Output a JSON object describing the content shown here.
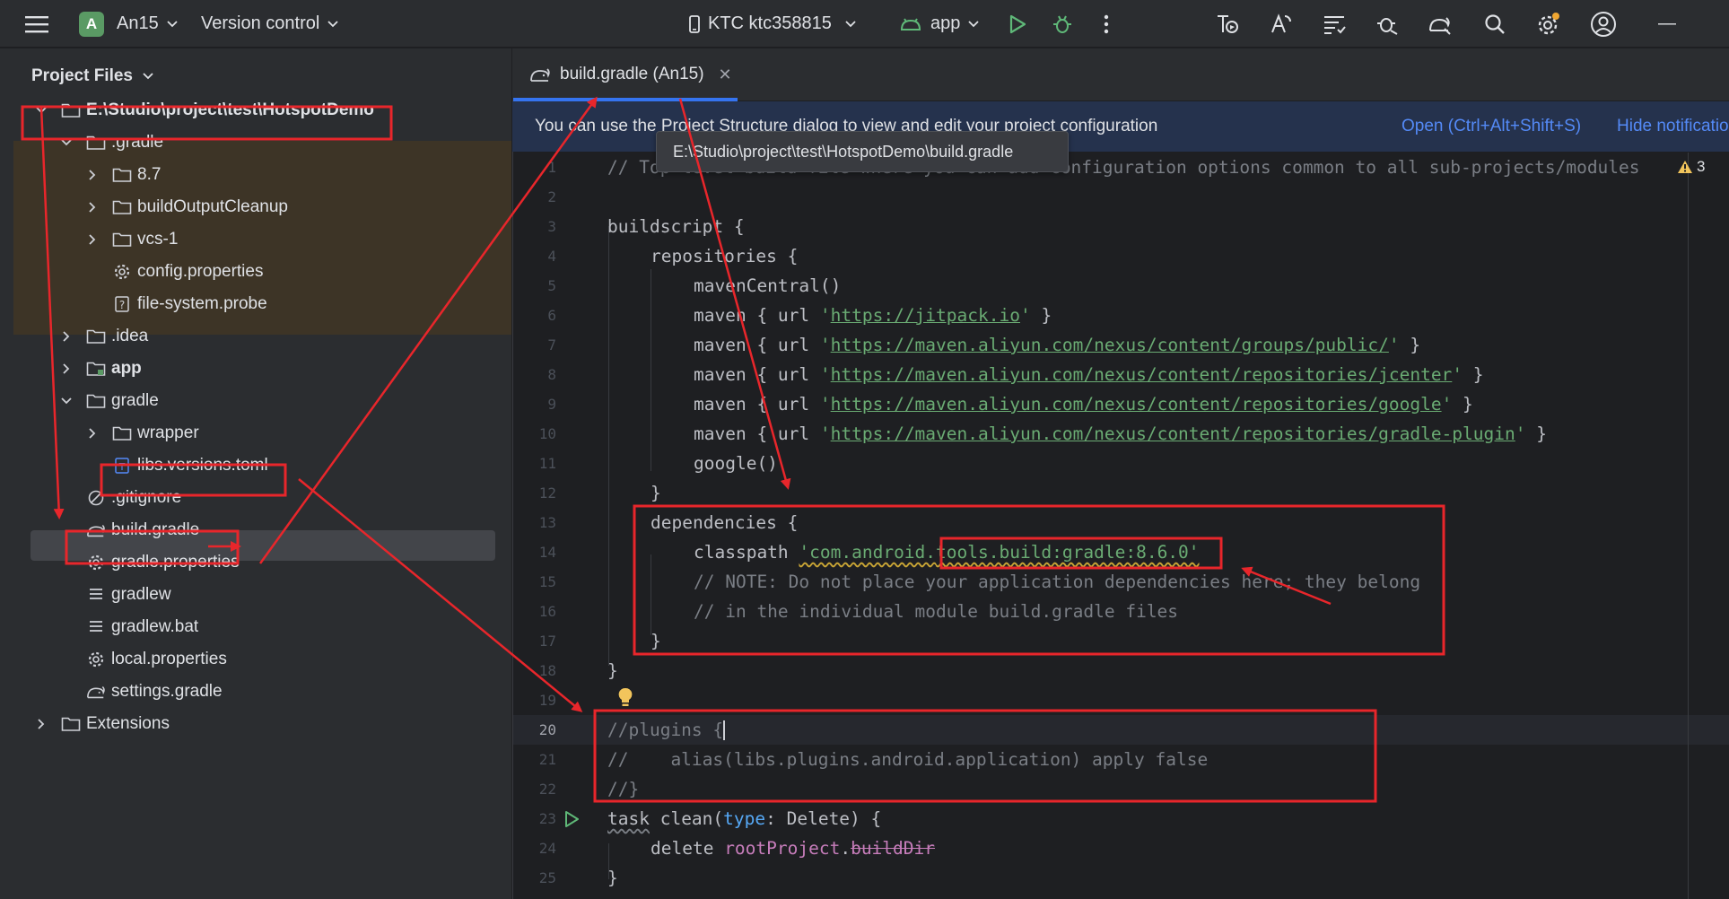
{
  "toolbar": {
    "project_initial": "A",
    "project_name": "An15",
    "vcs_label": "Version control",
    "device_label": "KTC ktc358815",
    "run_config": "app",
    "window_minimize": "—"
  },
  "project_panel": {
    "title": "Project Files",
    "items": [
      {
        "label": "E:\\Studio\\project\\test\\HotspotDemo",
        "icon": "folder-icon"
      },
      {
        "label": ".gradle",
        "icon": "folder-icon"
      },
      {
        "label": "8.7",
        "icon": "folder-icon"
      },
      {
        "label": "buildOutputCleanup",
        "icon": "folder-icon"
      },
      {
        "label": "vcs-1",
        "icon": "folder-icon"
      },
      {
        "label": "config.properties",
        "icon": "gear-icon"
      },
      {
        "label": "file-system.probe",
        "icon": "unknown-file-icon"
      },
      {
        "label": ".idea",
        "icon": "folder-icon"
      },
      {
        "label": "app",
        "icon": "module-folder-icon"
      },
      {
        "label": "gradle",
        "icon": "folder-icon"
      },
      {
        "label": "wrapper",
        "icon": "folder-icon"
      },
      {
        "label": "libs.versions.toml",
        "icon": "toml-file-icon"
      },
      {
        "label": ".gitignore",
        "icon": "ignore-file-icon"
      },
      {
        "label": "build.gradle",
        "icon": "gradle-icon"
      },
      {
        "label": "gradle.properties",
        "icon": "gear-icon"
      },
      {
        "label": "gradlew",
        "icon": "text-file-icon"
      },
      {
        "label": "gradlew.bat",
        "icon": "text-file-icon"
      },
      {
        "label": "local.properties",
        "icon": "gear-icon"
      },
      {
        "label": "settings.gradle",
        "icon": "gradle-icon"
      },
      {
        "label": "Extensions",
        "icon": "folder-icon"
      }
    ]
  },
  "editor": {
    "tab_label": "build.gradle (An15)",
    "banner_text": "You can use the Project Structure dialog to view and edit your project configuration",
    "banner_open": "Open (Ctrl+Alt+Shift+S)",
    "banner_hide": "Hide notification",
    "tooltip": "E:\\Studio\\project\\test\\HotspotDemo\\build.gradle",
    "warning_count": "3",
    "current_line": "20",
    "line_numbers": [
      "1",
      "2",
      "3",
      "4",
      "5",
      "6",
      "7",
      "8",
      "9",
      "10",
      "11",
      "12",
      "13",
      "14",
      "15",
      "16",
      "17",
      "18",
      "19",
      "20",
      "21",
      "22",
      "23",
      "24",
      "25"
    ],
    "code": {
      "l1_comment": "// Top-level build file where you can add configuration options common to all sub-projects/modules",
      "l3_kw": "buildscript",
      "l3_brace": " {",
      "l4": "repositories {",
      "l5": "mavenCentral()",
      "maven_prefix": "maven { url ",
      "maven_suffix": " }",
      "quote": "'",
      "url_6": "https://jitpack.io",
      "url_7": "https://maven.aliyun.com/nexus/content/groups/public/",
      "url_8": "https://maven.aliyun.com/nexus/content/repositories/jcenter",
      "url_9": "https://maven.aliyun.com/nexus/content/repositories/google",
      "url_10": "https://maven.aliyun.com/nexus/content/repositories/gradle-plugin",
      "l11": "google()",
      "close_brace": "}",
      "l13": "dependencies {",
      "l14_classpath": "classpath ",
      "l14_str_a": "'com.android.",
      "l14_str_b": "tools.build:gradle:8.6.0'",
      "l15": "// NOTE: Do not place your application dependencies here; they belong",
      "l16": "// in the individual module build.gradle files",
      "l20": "//plugins {",
      "l21": "//    alias(libs.plugins.android.application) apply false",
      "l22": "//}",
      "l23_task": "task",
      "l23_clean": " clean(",
      "l23_type": "type",
      "l23_rest": ": Delete) {",
      "l24_delete": "delete ",
      "l24_root": "rootProject",
      "l24_dot": ".",
      "l24_builddir": "buildDir"
    }
  },
  "colors": {
    "annotation_red": "#e8262b",
    "accent_blue": "#3574f0",
    "string_green": "#6aab73",
    "comment_gray": "#7a7e85"
  }
}
